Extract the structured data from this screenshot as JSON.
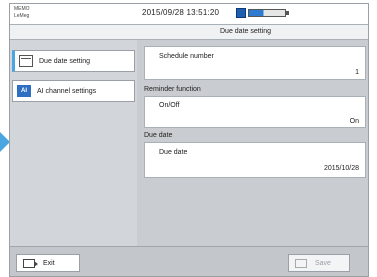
{
  "status": {
    "model_line1": "MEMO",
    "model_line2": "LeMeg",
    "datetime": "2015/09/28  13:51:20"
  },
  "page": {
    "title": "Due date setting"
  },
  "nav": {
    "items": [
      {
        "label": "Due date setting",
        "icon": "calendar-icon"
      },
      {
        "label": "AI channel settings",
        "icon": "ai-icon",
        "icon_text": "AI"
      }
    ]
  },
  "fields": {
    "schedule_number": {
      "label": "Schedule number",
      "value": "1"
    },
    "reminder": {
      "section": "Reminder function",
      "label": "On/Off",
      "value": "On"
    },
    "due_date": {
      "section": "Due date",
      "label": "Due date",
      "value": "2015/10/28"
    }
  },
  "buttons": {
    "exit": "Exit",
    "save": "Save"
  },
  "colors": {
    "accent": "#4aa6e0",
    "icon_blue": "#2e6fc2",
    "panel_bg": "#c9ccd0"
  }
}
